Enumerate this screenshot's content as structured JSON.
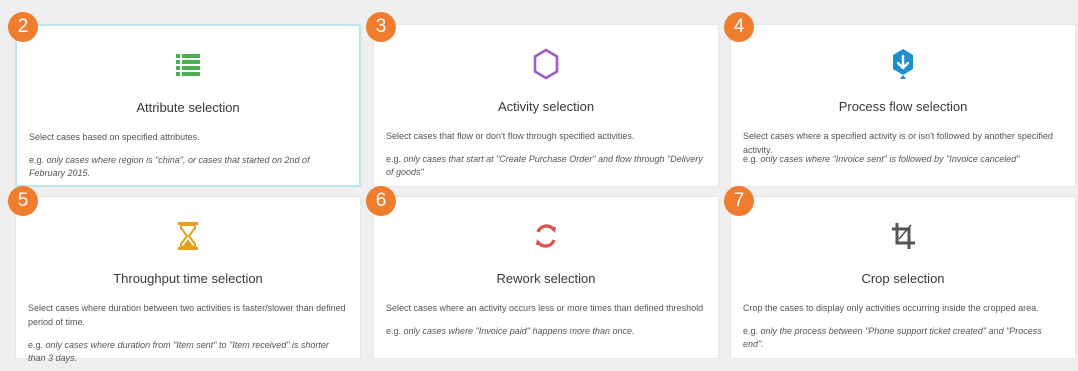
{
  "cards": [
    {
      "number": "2",
      "title": "Attribute selection",
      "description": "Select cases based on specified attributes.",
      "example_prefix": "e.g.",
      "example": "only cases where region is \"china\", or cases that started on 2nd of February 2015.",
      "icon": "list-icon",
      "icon_color": "#4caf50"
    },
    {
      "number": "3",
      "title": "Activity selection",
      "description": "Select cases that flow or don't flow through specified activities.",
      "example_prefix": "e.g.",
      "example": "only cases that start at \"Create Purchase Order\" and flow through \"Delivery of goods\"",
      "icon": "hexagon-icon",
      "icon_color": "#9c5bc8"
    },
    {
      "number": "4",
      "title": "Process flow selection",
      "description": "Select cases where a specified activity is or isn't followed by another specified activity.",
      "example_prefix": "e.g.",
      "example": "only cases where \"Invoice sent\" is followed by \"Invoice canceled\"",
      "icon": "process-flow-icon",
      "icon_color": "#1d8fd1"
    },
    {
      "number": "5",
      "title": "Throughput time selection",
      "description": "Select cases where duration between two activities is faster/slower than defined period of time.",
      "example_prefix": "e.g.",
      "example": "only cases where duration from \"Item sent\" to \"Item received\" is shorter than 3 days.",
      "icon": "hourglass-icon",
      "icon_color": "#e0a21b"
    },
    {
      "number": "6",
      "title": "Rework selection",
      "description": "Select cases where an activity occurs less or more times than defined threshold",
      "example_prefix": "e.g.",
      "example": "only cases where \"Invoice paid\" happens more than once.",
      "icon": "rework-icon",
      "icon_color": "#d9534f"
    },
    {
      "number": "7",
      "title": "Crop selection",
      "description": "Crop the cases to display only activities occurring inside the cropped area.",
      "example_prefix": "e.g.",
      "example": "only the process between \"Phone support ticket created\" and \"Process end\".",
      "icon": "crop-icon",
      "icon_color": "#555555"
    }
  ],
  "theme": {
    "badge_color": "#f07c2e",
    "selected_border": "#bfe3ea"
  }
}
